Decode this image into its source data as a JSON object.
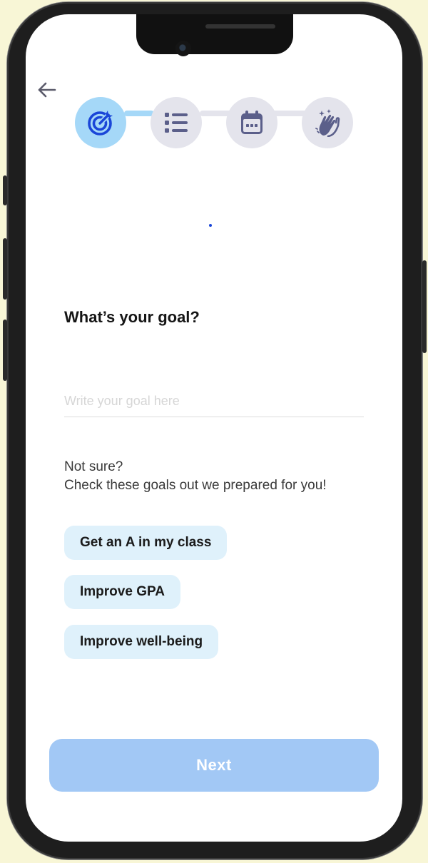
{
  "back": {
    "icon": "arrow-left-icon"
  },
  "stepper": {
    "steps": [
      {
        "icon": "target-icon",
        "state": "active"
      },
      {
        "icon": "list-icon",
        "state": "inactive"
      },
      {
        "icon": "calendar-icon",
        "state": "inactive"
      },
      {
        "icon": "clapping-hands-icon",
        "state": "inactive"
      }
    ],
    "active_color": "#a5d8f8",
    "inactive_color": "#e4e4ec"
  },
  "main": {
    "question": "What’s your goal?",
    "input": {
      "value": "",
      "placeholder": "Write your goal here"
    },
    "hint_line1": "Not sure?",
    "hint_line2": "Check these goals out we prepared for you!",
    "suggestions": [
      "Get an A in my class",
      "Improve GPA",
      "Improve well-being"
    ]
  },
  "footer": {
    "next_label": "Next",
    "next_color": "#a2c8f5"
  }
}
